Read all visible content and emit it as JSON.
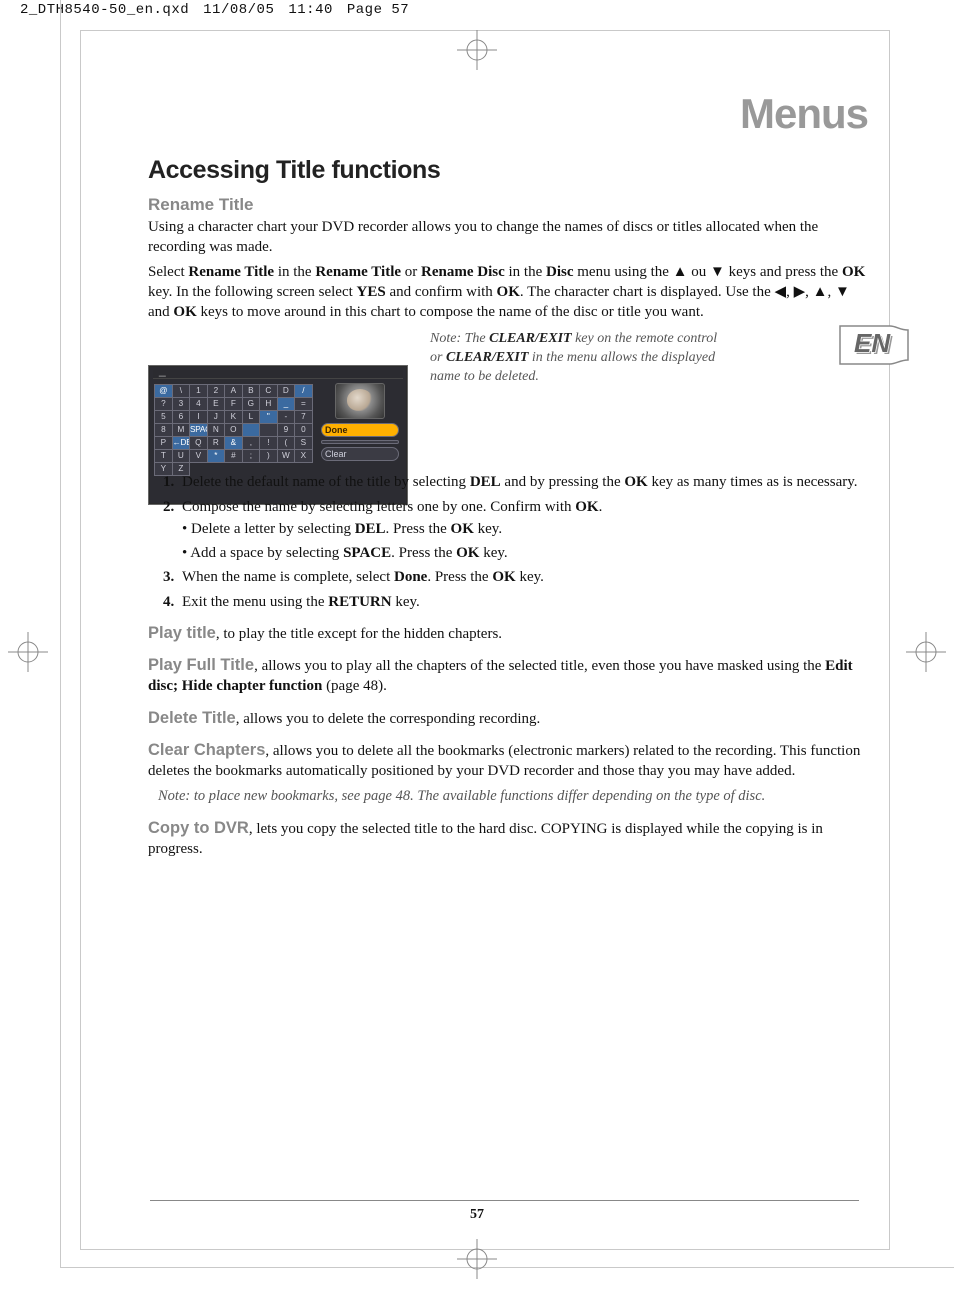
{
  "header": {
    "filename": "2_DTH8540-50_en.qxd",
    "date": "11/08/05",
    "time": "11:40",
    "page_label": "Page 57"
  },
  "lang_tab": "EN",
  "h1": "Menus",
  "h2": "Accessing Title functions",
  "h3_rename": "Rename Title",
  "intro": {
    "p1": "Using a character chart your DVD recorder allows you to change the names of discs or titles allocated when the recording was made.",
    "p2a": "Select ",
    "p2_s1": "Rename Title",
    "p2b": " in the ",
    "p2_s2": "Rename Title",
    "p2c": " or ",
    "p2_s3": "Rename Disc",
    "p2d": " in the ",
    "p2_s4": "Disc",
    "p2e": " menu using the ",
    "p2_up": "▲",
    "p2f": " ou ",
    "p2_down": "▼",
    "p2g": " keys and press the ",
    "p2_s5": "OK",
    "p2h": " key. In the following screen select ",
    "p2_s6": "YES",
    "p2i": " and confirm with ",
    "p2_s7": "OK",
    "p2j": ". The character chart is displayed. Use the ",
    "p2_l": "◀",
    "p2_r": "▶",
    "p2_u2": "▲",
    "p2_d2": "▼",
    "p2k": " and ",
    "p2_s8": "OK",
    "p2l": " keys to move around in this chart to compose the name of the disc or title you want."
  },
  "char_chart": {
    "rows": [
      [
        "@",
        "\\",
        "1",
        "2",
        "A",
        "B",
        "C",
        "D"
      ],
      [
        "/",
        "?",
        "3",
        "4",
        "E",
        "F",
        "G",
        "H"
      ],
      [
        "_",
        "=",
        "5",
        "6",
        "I",
        "J",
        "K",
        "L"
      ],
      [
        "\"",
        "-",
        "7",
        "8",
        "M",
        "SPACE",
        "N",
        "O"
      ],
      [
        " ",
        " ",
        "9",
        "0",
        "P",
        "←DEL",
        "Q",
        "R"
      ],
      [
        "&",
        ",",
        "!",
        "(",
        "S",
        "T",
        "U",
        "V"
      ],
      [
        "*",
        "#",
        ";",
        ")",
        "W",
        "X",
        "Y",
        "Z"
      ]
    ],
    "buttons": {
      "done": "Done",
      "blank": " ",
      "clear": "Clear"
    }
  },
  "note_box": {
    "pre": "Note: The ",
    "b1": "CLEAR/EXIT",
    "mid": " key on the remote control or ",
    "b2": "CLEAR/EXIT",
    "post": " in the menu allows the displayed name to be deleted."
  },
  "steps": {
    "s1a": "Delete the default name of the title by selecting ",
    "s1_b1": "DEL",
    "s1b": " and by pressing the ",
    "s1_b2": "OK",
    "s1c": " key as many times as is necessary.",
    "s2a": " Compose the name by selecting letters one by one. Confirm with ",
    "s2_b1": "OK",
    "s2b": ".",
    "s2_bul1a": "Delete a letter by selecting ",
    "s2_bul1_b": "DEL",
    "s2_bul1b": ". Press the ",
    "s2_bul1_b2": "OK",
    "s2_bul1c": " key.",
    "s2_bul2a": "Add a space by selecting ",
    "s2_bul2_b": "SPACE",
    "s2_bul2b": ". Press the ",
    "s2_bul2_b2": "OK",
    "s2_bul2c": " key.",
    "s3a": "When the name is complete, select ",
    "s3_b1": "Done",
    "s3b": ". Press the ",
    "s3_b2": "OK",
    "s3c": " key.",
    "s4a": "Exit the menu using the ",
    "s4_b1": "RETURN",
    "s4b": " key."
  },
  "features": {
    "play_title_h": "Play title",
    "play_title_t": ", to play the title except for the hidden chapters.",
    "play_full_h": "Play Full Title",
    "play_full_t1": ", allows you to play all the chapters of the selected title, even those you have masked using the ",
    "play_full_b": "Edit disc; Hide chapter function",
    "play_full_t2": " (page 48).",
    "delete_h": "Delete Title",
    "delete_t": ", allows you to delete the corresponding recording.",
    "clear_h": "Clear Chapters",
    "clear_t": ", allows you to delete all the bookmarks (electronic markers) related to the recording. This function deletes the bookmarks automatically positioned by your DVD recorder and those thay you may have added.",
    "clear_note": "Note: to place new bookmarks, see page 48.  The available functions differ depending on the type of disc.",
    "copy_h": "Copy to DVR",
    "copy_t": ", lets you copy the selected title to the hard disc. COPYING is displayed while the copying is in progress."
  },
  "page_number": "57"
}
